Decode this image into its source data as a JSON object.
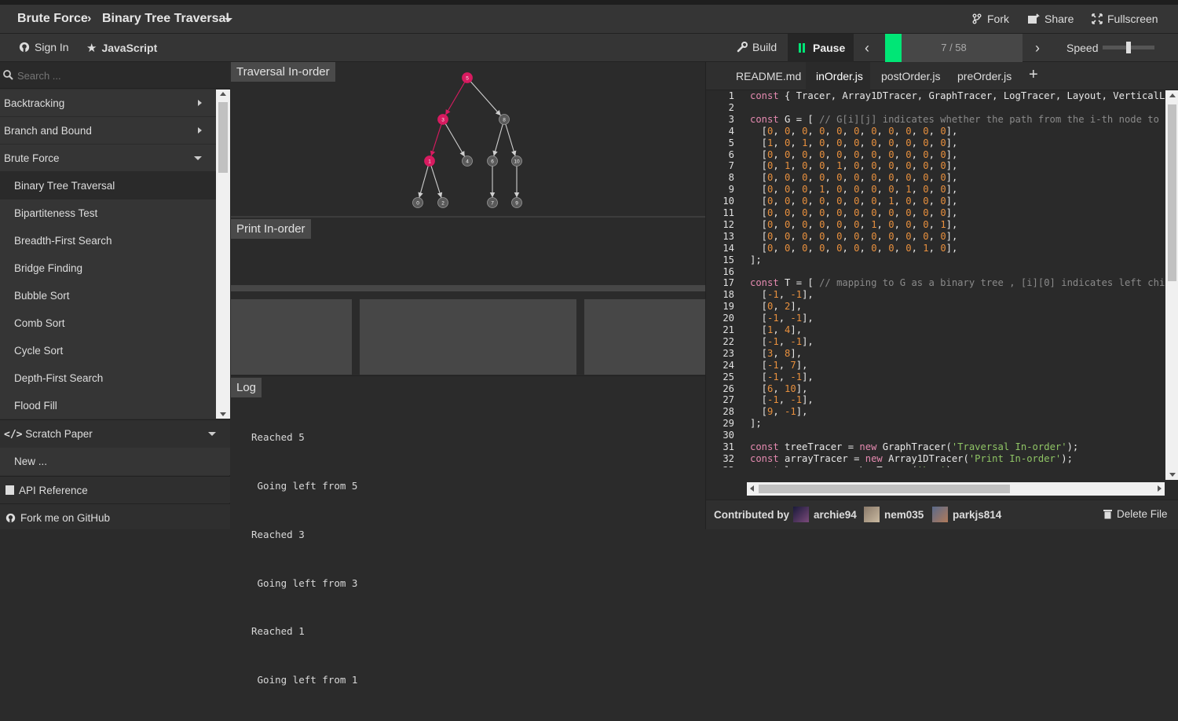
{
  "header": {
    "category": "Brute Force",
    "algorithm": "Binary Tree Traversal",
    "fork": "Fork",
    "share": "Share",
    "fullscreen": "Fullscreen"
  },
  "toolbar": {
    "sign_in": "Sign In",
    "language": "JavaScript",
    "build": "Build",
    "pause": "Pause",
    "progress_text": "7 / 58",
    "progress_fraction": 0.12,
    "speed": "Speed",
    "speed_fraction": 0.5
  },
  "sidebar": {
    "search_placeholder": "Search ...",
    "categories": [
      "Backtracking",
      "Branch and Bound",
      "Brute Force"
    ],
    "items": [
      "Binary Tree Traversal",
      "Bipartiteness Test",
      "Breadth-First Search",
      "Bridge Finding",
      "Bubble Sort",
      "Comb Sort",
      "Cycle Sort",
      "Depth-First Search",
      "Flood Fill"
    ],
    "scratch": "Scratch Paper",
    "new": "New ...",
    "api": "API Reference",
    "github": "Fork me on GitHub"
  },
  "panels": {
    "traversal": "Traversal In-order",
    "print": "Print In-order",
    "log": "Log",
    "log_lines": [
      "Reached 5",
      " Going left from 5",
      "Reached 3",
      " Going left from 3",
      "Reached 1",
      " Going left from 1"
    ]
  },
  "graph": {
    "nodes": [
      "5",
      "3",
      "8",
      "1",
      "4",
      "6",
      "10",
      "0",
      "2",
      "7",
      "9"
    ],
    "highlighted": [
      "5",
      "3",
      "1"
    ]
  },
  "editor": {
    "tabs": [
      "README.md",
      "inOrder.js",
      "postOrder.js",
      "preOrder.js",
      "+"
    ],
    "active_tab": "inOrder.js",
    "contributed_by": "Contributed by",
    "contributors": [
      "archie94",
      "nem035",
      "parkjs814"
    ],
    "delete_file": "Delete File"
  },
  "colors": {
    "accent_progress": "#00e676",
    "highlight_node": "#d81b60"
  }
}
